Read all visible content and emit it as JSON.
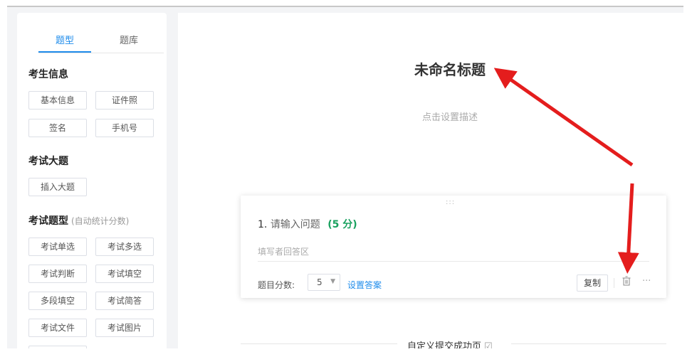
{
  "sidebar": {
    "tabs": [
      {
        "label": "题型",
        "active": true
      },
      {
        "label": "题库",
        "active": false
      }
    ],
    "sections": {
      "candidate_info": {
        "title": "考生信息",
        "buttons": [
          "基本信息",
          "证件照",
          "签名",
          "手机号"
        ]
      },
      "exam_section": {
        "title": "考试大题",
        "buttons": [
          "插入大题"
        ]
      },
      "exam_types": {
        "title": "考试题型",
        "hint": "(自动统计分数)",
        "buttons": [
          "考试单选",
          "考试多选",
          "考试判断",
          "考试填空",
          "多段填空",
          "考试简答",
          "考试文件",
          "考试图片"
        ]
      }
    }
  },
  "main": {
    "title": "未命名标题",
    "description": "点击设置描述",
    "question": {
      "drag_handle": ":::",
      "number": "1.",
      "placeholder": "请输入问题",
      "score_text": "(5 分)",
      "answer_area": "填写者回答区",
      "score_label": "题目分数:",
      "score_value": "5",
      "set_answer": "设置答案",
      "copy": "复制"
    },
    "success_page": "自定义提交成功页"
  },
  "colors": {
    "accent": "#1f8ceb",
    "score_green": "#19a15f",
    "annotation_arrow": "#e41d1d"
  },
  "icons": {
    "drag": "drag-handle-icon",
    "caret": "caret-down-icon",
    "trash": "trash-icon",
    "more": "more-icon",
    "edit": "edit-icon",
    "arrow": "red-arrow-annotation"
  }
}
